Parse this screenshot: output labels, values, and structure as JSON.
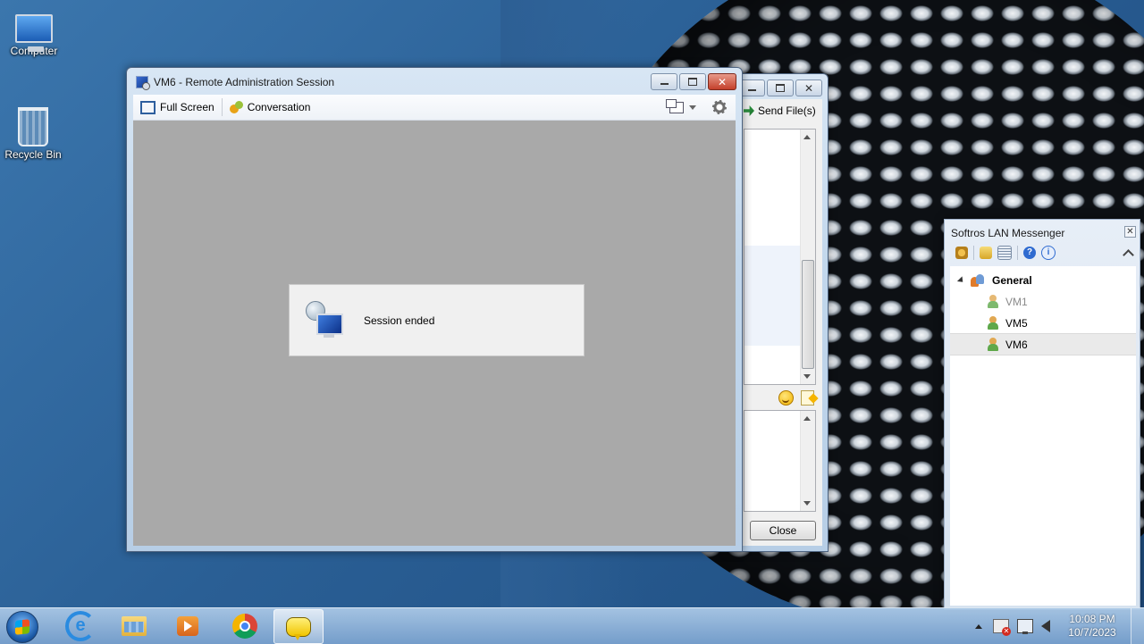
{
  "desktop": {
    "icons": [
      {
        "label": "Computer"
      },
      {
        "label": "Recycle Bin"
      }
    ]
  },
  "main_window": {
    "title": "VM6 - Remote Administration Session",
    "toolbar": {
      "full_screen": "Full Screen",
      "conversation": "Conversation"
    },
    "dialog": {
      "message": "Session ended"
    }
  },
  "chat_window": {
    "send_files": "Send File(s)",
    "close": "Close"
  },
  "lan_messenger": {
    "title": "Softros LAN Messenger",
    "group": "General",
    "contacts": [
      {
        "name": "VM1",
        "status": "offline",
        "color": "#8a8a8a"
      },
      {
        "name": "VM5",
        "status": "online",
        "color": "#000000"
      },
      {
        "name": "VM6",
        "status": "online",
        "color": "#000000",
        "selected": true
      }
    ]
  },
  "taskbar": {
    "apps": [
      "start-button",
      "internet-explorer",
      "file-explorer",
      "media-player",
      "chrome",
      "softros-messenger"
    ],
    "active_app": "softros-messenger"
  },
  "clock": {
    "time": "10:08 PM",
    "date": "10/7/2023"
  }
}
